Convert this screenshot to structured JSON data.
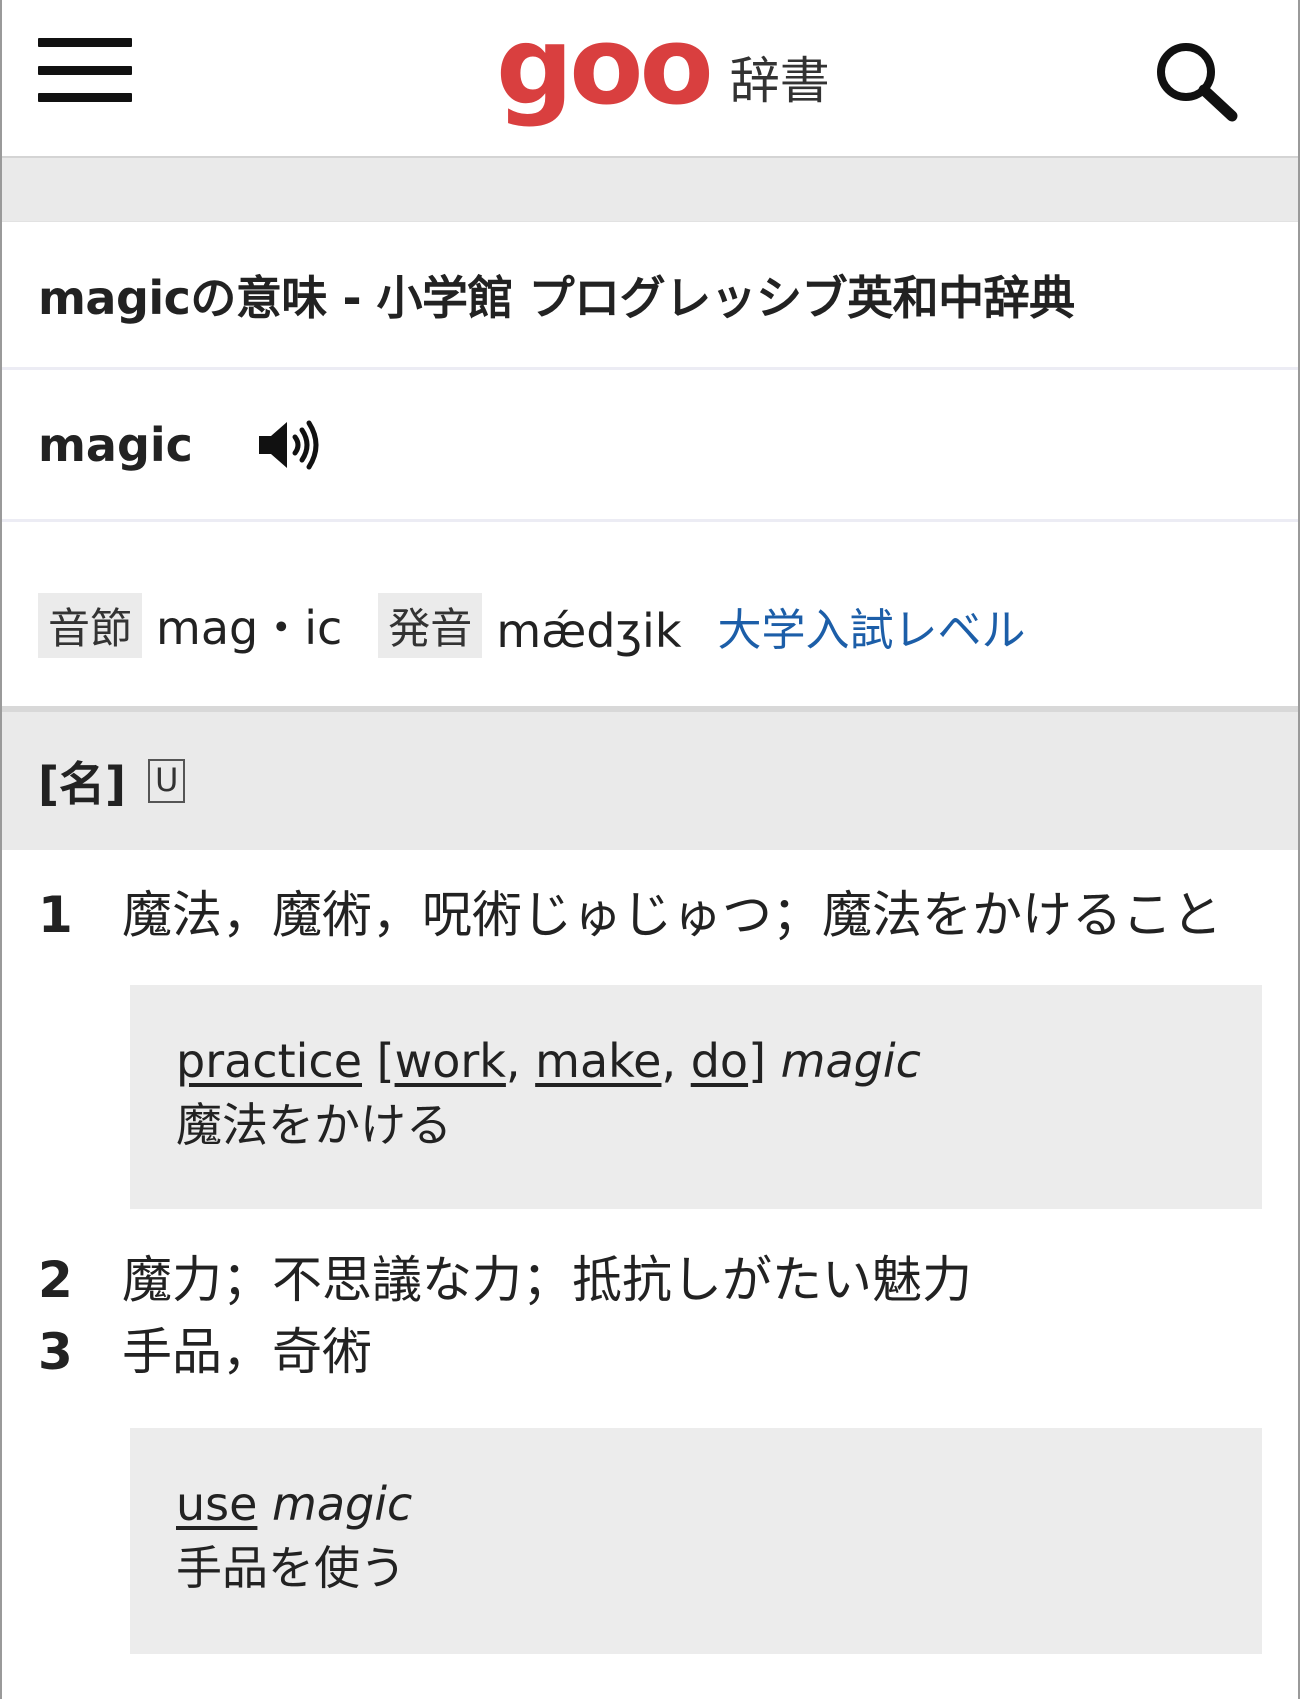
{
  "header": {
    "logo_mark": "goo",
    "logo_text": "辞書",
    "accent_color": "#d93f3f"
  },
  "entry": {
    "page_title": "magicの意味 - 小学館 プログレッシブ英和中辞典",
    "headword": "magic",
    "syllable_tag": "音節",
    "syllables": "mag・ic",
    "pronunciation_tag": "発音",
    "pronunciation": "mǽdʒik",
    "level_link": "大学入試レベル",
    "part_of_speech": "[名]",
    "usage_mark": "U"
  },
  "definitions": [
    {
      "num": "1",
      "text": "魔法，魔術，呪術じゅじゅつ；魔法をかけること",
      "example": {
        "en_parts": [
          "practice",
          " [",
          "work",
          ", ",
          "make",
          ", ",
          "do",
          "] ",
          "magic"
        ],
        "ja": "魔法をかける"
      }
    },
    {
      "num": "2",
      "text": "魔力；不思議な力；抵抗しがたい魅力"
    },
    {
      "num": "3",
      "text": "手品，奇術",
      "example": {
        "en_parts": [
          "use",
          " ",
          "magic"
        ],
        "ja": "手品を使う"
      }
    }
  ],
  "icons": [
    "menu-icon",
    "search-icon",
    "speaker-icon"
  ]
}
